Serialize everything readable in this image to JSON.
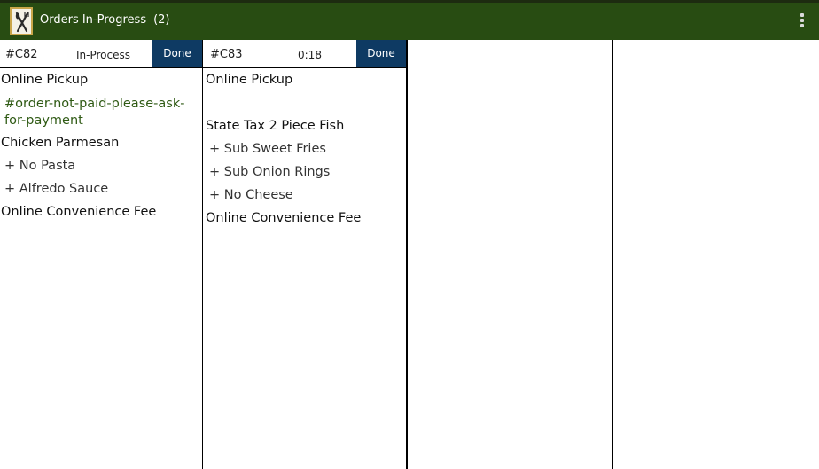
{
  "appbar": {
    "title": "Orders In-Progress",
    "count": "(2)",
    "app_icon": "fork-knife-icon",
    "menu_icon": "overflow-menu-icon",
    "background_color": "#284c12"
  },
  "orders": [
    {
      "id": "#C82",
      "status": "In-Process",
      "done_label": "Done",
      "type": "Online Pickup",
      "note_line1": "#order-not-paid-please-ask-",
      "note_line2": "for-payment",
      "items": [
        {
          "name": "Chicken Parmesan",
          "modifiers": [
            "+ No Pasta",
            "+ Alfredo Sauce"
          ]
        },
        {
          "name": "Online Convenience Fee",
          "modifiers": []
        }
      ]
    },
    {
      "id": "#C83",
      "status": "0:18",
      "done_label": "Done",
      "type": "Online Pickup",
      "items": [
        {
          "name": "State Tax 2 Piece Fish",
          "modifiers": [
            "+ Sub Sweet Fries",
            "+ Sub Onion Rings",
            "+ No Cheese"
          ]
        },
        {
          "name": "Online Convenience Fee",
          "modifiers": []
        }
      ]
    }
  ],
  "colors": {
    "done_button": "#0e3a63",
    "note_text": "#2f5a14"
  }
}
